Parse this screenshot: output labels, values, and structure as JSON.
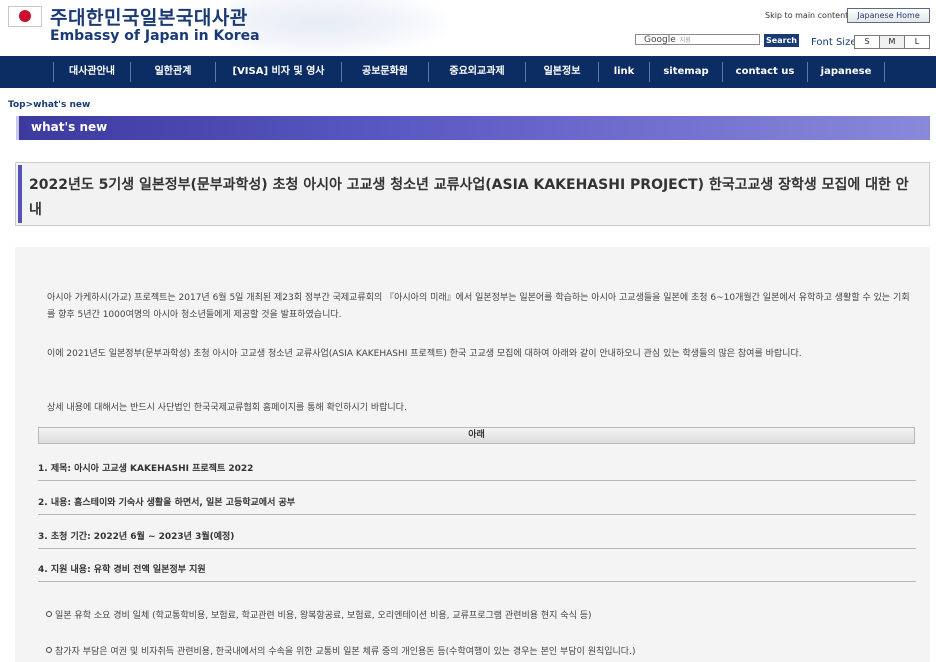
{
  "header": {
    "title_ko": "주대한민국일본국대사관",
    "title_en": "Embassy of Japan in Korea",
    "skip_link": "Skip to main content",
    "japanese_home": "Japanese Home",
    "search_placeholder": "Google",
    "search_sub": "지원",
    "search_button": "Search",
    "font_size_label": "Font Size",
    "font_sizes": [
      "S",
      "M",
      "L"
    ]
  },
  "nav": {
    "items": [
      {
        "label": "대사관안내"
      },
      {
        "label": "일한관계"
      },
      {
        "label": "[VISA] 비자 및 영사"
      },
      {
        "label": "공보문화원"
      },
      {
        "label": "중요외교과제"
      },
      {
        "label": "일본정보"
      },
      {
        "label": "link"
      },
      {
        "label": "sitemap"
      },
      {
        "label": "contact us"
      },
      {
        "label": "japanese"
      }
    ]
  },
  "breadcrumb": {
    "top": "Top",
    "separator": ">",
    "current": "what's new"
  },
  "section_title": "what's new",
  "article": {
    "title": "2022년도 5기생 일본정부(문부과학성) 초청 아시아 고교생 청소년 교류사업(ASIA KAKEHASHI PROJECT) 한국고교생 장학생 모집에 대한 안내",
    "paragraphs": [
      "아시아 가케하시(가교) 프로젝트는 2017년 6월 5일 개최된 제23회 정부간 국제교류회의 『아시아의 미래』에서 일본정부는 일본어를 학습하는 아시아 고교생들을 일본에 초청 6~10개월간 일본에서 유학하고 생활할 수 있는 기회를 향후 5년간 1000여명의 아시아 청소년들에게 제공할 것을 발표하였습니다.",
      "이에 2021년도 일본정부(문부과학성) 초청 아시아 고교생 청소년 교류사업(ASIA KAKEHASHI 프로젝트) 한국 고교생 모집에 대하여 아래와 같이 안내하오니 관심 있는 학생들의 많은 참여를 바랍니다.",
      "상세 내용에 대해서는 반드시 사단법인 한국국제교류협회 홈페이지를 통해 확인하시기 바랍니다."
    ],
    "notice_heading": "아래",
    "items": [
      "1. 제목: 아시아 고교생 KAKEHASHI 프로젝트 2022",
      "2. 내용: 홈스테이와 기숙사 생활을 하면서, 일본 고등학교에서 공부",
      "3. 초청 기간: 2022년 6월 ~ 2023년 3월(예정)",
      "4. 지원 내용: 유학 경비 전액 일본정부 지원"
    ],
    "sub_items": [
      "일본 유학 소요 경비 일체 (학교통학비용, 보험료, 학교관련 비용, 왕복항공료, 보험료, 오리엔테이션 비용, 교류프로그램 관련비용 현지 숙식 등)",
      "참가자 부담은 여권 및 비자취득 관련비용, 한국내에서의 수속을 위한 교통비 일본 체류 중의 개인용돈 등(수학여행이 있는 경우는 본인 부담이 원칙입니다.)"
    ]
  },
  "colors": {
    "nav_bg": "#0b2d63",
    "brand_text": "#1a3a76",
    "section_header": "#4a48b4"
  }
}
